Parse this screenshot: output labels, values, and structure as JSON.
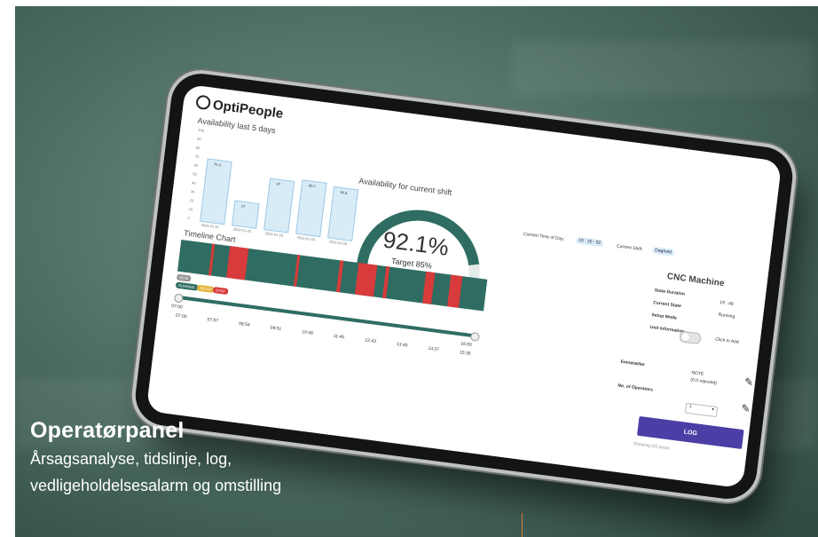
{
  "app": {
    "logo_text": "OptiPeople"
  },
  "availability_days": {
    "title": "Availability last 5 days",
    "y_ticks": [
      "100",
      "90",
      "80",
      "70",
      "60",
      "50",
      "40",
      "30",
      "20",
      "10",
      "0"
    ],
    "bars": [
      {
        "label": "70.4",
        "date": "2024-01-01",
        "value": 70.4
      },
      {
        "label": "27",
        "date": "2024-01-02",
        "value": 27
      },
      {
        "label": "57",
        "date": "2024-01-03",
        "value": 57
      },
      {
        "label": "60.2",
        "date": "2024-01-04",
        "value": 60.2
      },
      {
        "label": "56.8",
        "date": "2024-01-05",
        "value": 56.8
      }
    ]
  },
  "shift": {
    "title": "Availability for current shift",
    "value_text": "92.1%",
    "value": 92.1,
    "target_text": "Target 85%",
    "time_label": "Current Time of Day:",
    "time_value": "15 : 20 : 52",
    "shift_label": "Current Shift:",
    "shift_value": "Daghold"
  },
  "timeline": {
    "title": "Timeline Chart",
    "chip_status": "09:40",
    "chip_running": "RUNNING",
    "chip_setup": "SETUP",
    "chip_stop": "STOP",
    "start_label": "07:00",
    "end_label": "16:00",
    "ticks": [
      "07:00",
      "07:57",
      "08:54",
      "09:51",
      "10:48",
      "11:45",
      "12:43",
      "13:40",
      "14:37",
      "15:35"
    ]
  },
  "machine": {
    "title": "CNC Machine",
    "rows": [
      {
        "label": "State Duration",
        "value": "19 : 48"
      },
      {
        "label": "Current State",
        "value": "Running"
      },
      {
        "label": "Setup Mode",
        "value": ""
      },
      {
        "label": "Unit Information",
        "value": "Click to Add"
      }
    ],
    "kpi_label": "Emnetæller",
    "kpi_value": "NOTE",
    "kpi_sub": "(0.0 rejected)",
    "operators_label": "No. of Operators",
    "operators_value": "1",
    "log_label": "LOG",
    "showing": "Showing 0/0 posts"
  },
  "caption": {
    "heading": "Operatørpanel",
    "line1": "Årsagsanalyse, tidslinje, log,",
    "line2": "vedligeholdelsesalarm og omstilling"
  },
  "colors": {
    "teal": "#2f6d62",
    "red": "#d83b3b",
    "purple": "#4b3fa6",
    "bar_fill": "#d8ecf8"
  }
}
